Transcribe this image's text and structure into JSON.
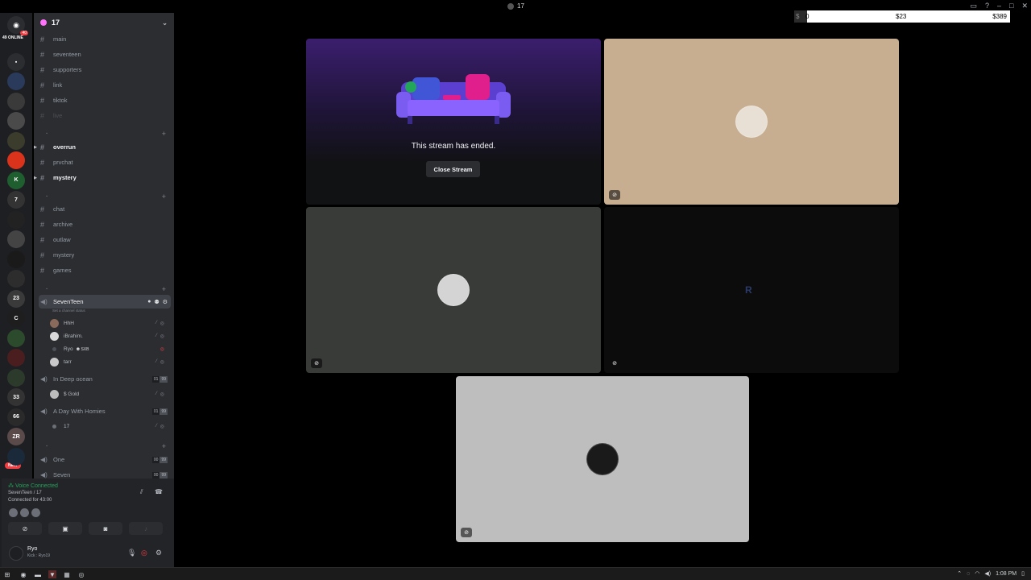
{
  "window": {
    "title": "17"
  },
  "overlay": {
    "seg_a": "$",
    "seg_a2": "0",
    "seg_b": "$23",
    "seg_c": "$389"
  },
  "rail": {
    "online_text": "49 ONLINE",
    "home_badge": "40",
    "servers": [
      {
        "label": "",
        "badge": ""
      },
      {
        "label": "",
        "badge": ""
      },
      {
        "label": "",
        "badge": ""
      },
      {
        "label": "",
        "badge": ""
      },
      {
        "label": "",
        "badge": ""
      },
      {
        "label": "K",
        "badge": ""
      },
      {
        "label": "7",
        "badge": ""
      },
      {
        "label": "",
        "badge": ""
      },
      {
        "label": "",
        "badge": ""
      },
      {
        "label": "",
        "badge": ""
      },
      {
        "label": "",
        "badge": "21"
      },
      {
        "label": "23",
        "badge": ""
      },
      {
        "label": "C",
        "badge": ""
      },
      {
        "label": "",
        "badge": ""
      },
      {
        "label": "",
        "badge": "61"
      },
      {
        "label": "",
        "badge": "12"
      },
      {
        "label": "33",
        "badge": ""
      },
      {
        "label": "66",
        "badge": ""
      },
      {
        "label": "ZR",
        "badge": ""
      },
      {
        "label": "",
        "badge": "3"
      }
    ],
    "new_label": "NEW"
  },
  "sidebar": {
    "server_name": "17",
    "channels_top": [
      "main",
      "seventeen",
      "supporters",
      "link",
      "tiktok",
      "live"
    ],
    "channels_mid": [
      "overrun",
      "prvchat",
      "mystery"
    ],
    "channels_text": [
      "chat",
      "archive",
      "outlaw",
      "mystery",
      "games"
    ],
    "voice_active": {
      "name": "SevenTeen",
      "status": "Set a channel status"
    },
    "members": [
      {
        "name": "HhH"
      },
      {
        "name": "iBrahim."
      },
      {
        "name": "Ryo",
        "tag": "SXB"
      },
      {
        "name": "tarr"
      }
    ],
    "voice_deep": {
      "name": "In Deep ocean",
      "count": "01",
      "limit": "99"
    },
    "deep_member": {
      "name": "$ Gold"
    },
    "voice_homies": {
      "name": "A Day With Homies",
      "count": "01",
      "limit": "99"
    },
    "homies_member": {
      "name": "17"
    },
    "voice_one": {
      "name": "One",
      "count": "00",
      "limit": "99"
    },
    "voice_seven": {
      "name": "Seven",
      "count": "00",
      "limit": "99"
    }
  },
  "voice_panel": {
    "status": "Voice Connected",
    "channel": "SevenTeen / 17",
    "connected_for": "Connected for 43:00"
  },
  "user_panel": {
    "name": "Ryo",
    "sub": "Kick : Ryo19"
  },
  "stage": {
    "ended_text": "This stream has ended.",
    "close_label": "Close Stream"
  },
  "taskbar": {
    "time": "1:08 PM"
  },
  "colors": {
    "accent_green": "#23a55a",
    "danger_red": "#f23f43",
    "sidebar_bg": "#2b2d31",
    "rail_bg": "#1e1f22"
  }
}
